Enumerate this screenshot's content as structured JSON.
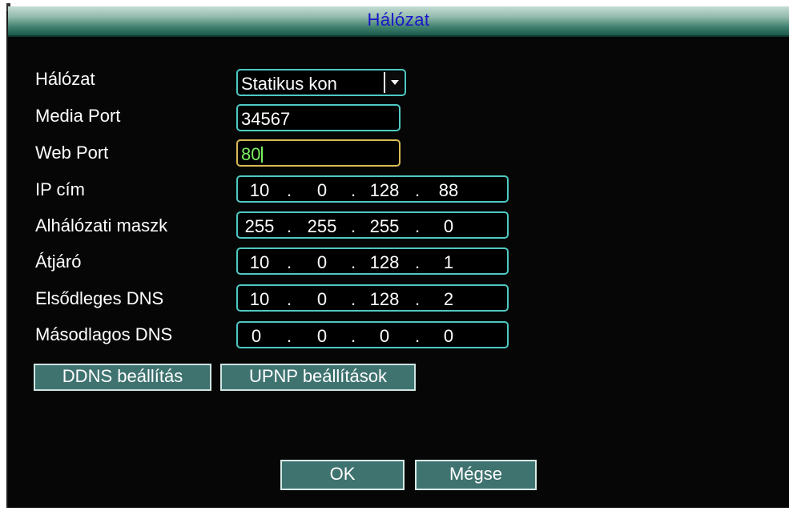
{
  "window": {
    "title": "Hálózat"
  },
  "fields": {
    "network_mode": {
      "label": "Hálózat",
      "value": "Statikus kon"
    },
    "media_port": {
      "label": "Media Port",
      "value": "34567"
    },
    "web_port": {
      "label": "Web Port",
      "value": "80"
    },
    "ip": {
      "label": "IP cím",
      "octets": [
        "10",
        "0",
        "128",
        "88"
      ]
    },
    "subnet": {
      "label": "Alhálózati maszk",
      "octets": [
        "255",
        "255",
        "255",
        "0"
      ]
    },
    "gateway": {
      "label": "Átjáró",
      "octets": [
        "10",
        "0",
        "128",
        "1"
      ]
    },
    "dns1": {
      "label": "Elsődleges DNS",
      "octets": [
        "10",
        "0",
        "128",
        "2"
      ]
    },
    "dns2": {
      "label": "Másodlagos DNS",
      "octets": [
        "0",
        "0",
        "0",
        "0"
      ]
    }
  },
  "ip_separator": ".",
  "buttons": {
    "ddns": "DDNS beállítás",
    "upnp": "UPNP beállítások",
    "ok": "OK",
    "cancel": "Mégse"
  },
  "colors": {
    "field_border": "#4ec9c3",
    "focus_border": "#d7ba55",
    "focus_text": "#7cf060",
    "button_fill": "#3f7370",
    "title_text": "#1a16c8"
  },
  "icons": {
    "dropdown": "chevron-down-icon"
  }
}
